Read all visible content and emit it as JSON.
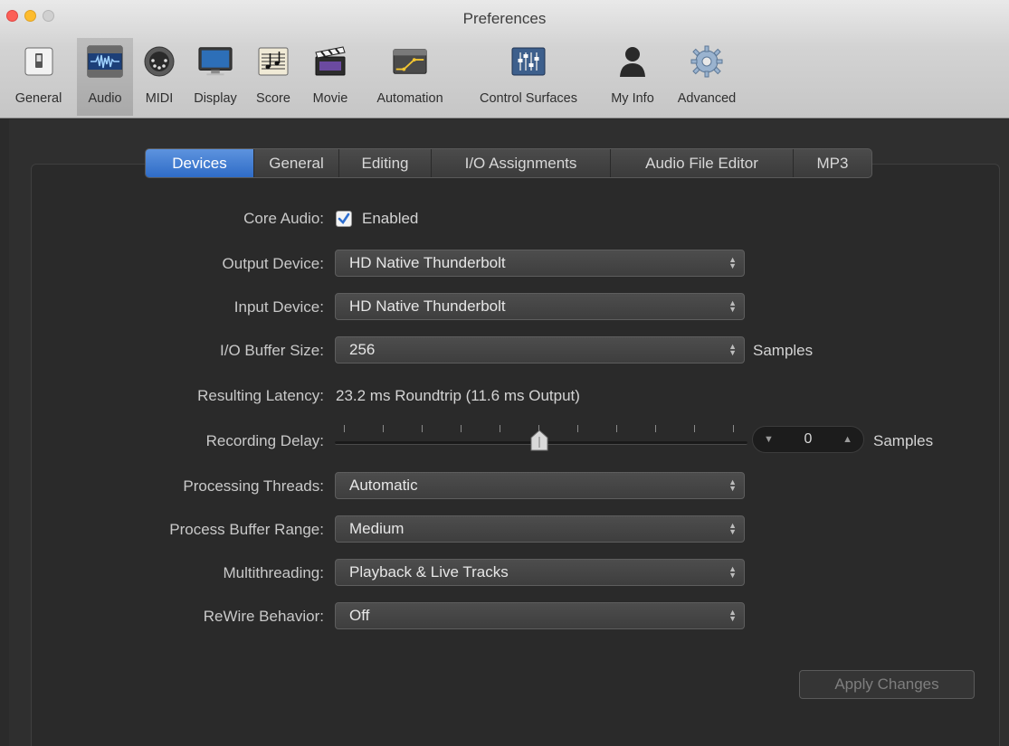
{
  "window": {
    "title": "Preferences"
  },
  "toolbar": {
    "items": [
      {
        "label": "General",
        "icon": "switch-icon"
      },
      {
        "label": "Audio",
        "icon": "waveform-icon"
      },
      {
        "label": "MIDI",
        "icon": "midi-connector-icon"
      },
      {
        "label": "Display",
        "icon": "monitor-icon"
      },
      {
        "label": "Score",
        "icon": "score-icon"
      },
      {
        "label": "Movie",
        "icon": "clapperboard-icon"
      },
      {
        "label": "Automation",
        "icon": "automation-icon"
      },
      {
        "label": "Control Surfaces",
        "icon": "faders-icon"
      },
      {
        "label": "My Info",
        "icon": "person-icon"
      },
      {
        "label": "Advanced",
        "icon": "gear-icon"
      }
    ],
    "selected": "Audio"
  },
  "tabs": [
    {
      "label": "Devices",
      "active": true
    },
    {
      "label": "General",
      "active": false
    },
    {
      "label": "Editing",
      "active": false
    },
    {
      "label": "I/O Assignments",
      "active": false
    },
    {
      "label": "Audio File Editor",
      "active": false
    },
    {
      "label": "MP3",
      "active": false
    }
  ],
  "form": {
    "core_audio": {
      "label": "Core Audio:",
      "checkbox_label": "Enabled",
      "checked": true
    },
    "output_device": {
      "label": "Output Device:",
      "value": "HD Native Thunderbolt"
    },
    "input_device": {
      "label": "Input Device:",
      "value": "HD Native Thunderbolt"
    },
    "io_buffer_size": {
      "label": "I/O Buffer Size:",
      "value": "256",
      "unit": "Samples"
    },
    "resulting_latency": {
      "label": "Resulting Latency:",
      "value": "23.2 ms Roundtrip (11.6 ms Output)"
    },
    "recording_delay": {
      "label": "Recording Delay:",
      "value": "0",
      "unit": "Samples"
    },
    "processing_threads": {
      "label": "Processing Threads:",
      "value": "Automatic"
    },
    "process_buffer_range": {
      "label": "Process Buffer Range:",
      "value": "Medium"
    },
    "multithreading": {
      "label": "Multithreading:",
      "value": "Playback & Live Tracks"
    },
    "rewire_behavior": {
      "label": "ReWire Behavior:",
      "value": "Off"
    }
  },
  "buttons": {
    "apply": "Apply Changes"
  },
  "colors": {
    "accent_tab": "#3a74cc",
    "background": "#2b2b2b",
    "checkbox_check": "#2f6fd0"
  }
}
